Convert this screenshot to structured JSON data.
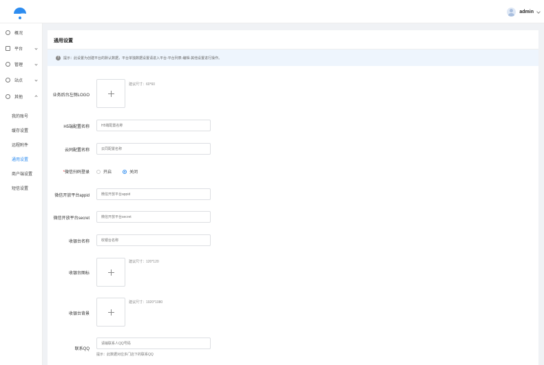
{
  "header": {
    "user_name": "admin"
  },
  "sidebar": {
    "nav": [
      {
        "label": "概况"
      },
      {
        "label": "平台"
      },
      {
        "label": "管理"
      },
      {
        "label": "站点"
      },
      {
        "label": "其他"
      }
    ],
    "sub_items": [
      "我的账号",
      "缓存设置",
      "远程附件",
      "通用设置",
      "商户端设置",
      "短信设置"
    ]
  },
  "card": {
    "title": "通用设置",
    "tip": "提示：此设置为创建平台的默认数据，平台单独数据设置请进入平台-平台列表-编辑-其他设置进行操作。"
  },
  "form": {
    "logo_label": "业务后台左侧LOGO",
    "logo_hint": "建议尺寸：60*60",
    "h5_label": "H5端配置名称",
    "h5_placeholder": "H5端配置名称",
    "cloud_label": "云同配置名称",
    "cloud_placeholder": "云同配置名称",
    "wx_scan_label": "微信扫码登录",
    "wx_scan_options": [
      "开启",
      "关闭"
    ],
    "wx_scan_selected": "关闭",
    "wx_appid_label": "微信开放平台appid",
    "wx_appid_placeholder": "微信开放平台appid",
    "wx_secret_label": "微信开放平台secret",
    "wx_secret_placeholder": "微信开放平台secret",
    "cashier_name_label": "收银台名称",
    "cashier_name_placeholder": "收银台名称",
    "cashier_icon_label": "收银台图标",
    "cashier_icon_hint": "建议尺寸：120*120",
    "cashier_bg_label": "收银台背景",
    "cashier_bg_hint": "建议尺寸：1920*1080",
    "qq_label": "联系QQ",
    "qq_placeholder": "请输联系人QQ号码",
    "qq_hint": "提示：此数据对应多门店下的联系QQ"
  },
  "colors": {
    "accent": "#2d8cf0",
    "required": "#ee3333"
  }
}
